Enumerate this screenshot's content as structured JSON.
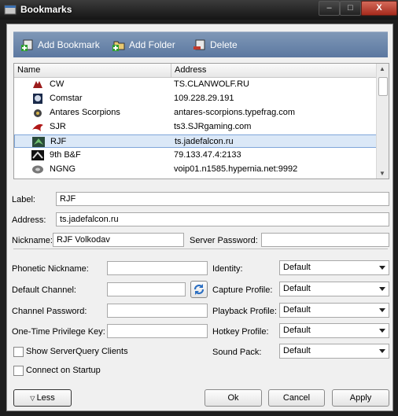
{
  "window": {
    "title": "Bookmarks",
    "controls": [
      "–",
      "□",
      "X"
    ]
  },
  "toolbar": {
    "add_bookmark": "Add Bookmark",
    "add_folder": "Add Folder",
    "delete": "Delete"
  },
  "list": {
    "headers": {
      "name": "Name",
      "address": "Address"
    },
    "rows": [
      {
        "name": "CW",
        "address": "TS.CLANWOLF.RU",
        "icon": "wolf-icon"
      },
      {
        "name": "Comstar",
        "address": "109.228.29.191",
        "icon": "comstar-icon"
      },
      {
        "name": "Antares Scorpions",
        "address": "antares-scorpions.typefrag.com",
        "icon": "scorpion-icon"
      },
      {
        "name": "SJR",
        "address": "ts3.SJRgaming.com",
        "icon": "sjr-icon"
      },
      {
        "name": "RJF",
        "address": "ts.jadefalcon.ru",
        "icon": "falcon-icon",
        "selected": true
      },
      {
        "name": "9th B&F",
        "address": "79.133.47.4:2133",
        "icon": "bf-icon"
      },
      {
        "name": "NGNG",
        "address": "voip01.n1585.hypernia.net:9992",
        "icon": "ngng-icon"
      }
    ]
  },
  "form": {
    "label": {
      "label": "Label:",
      "value": "RJF"
    },
    "address": {
      "label": "Address:",
      "value": "ts.jadefalcon.ru"
    },
    "nickname": {
      "label": "Nickname:",
      "value": "RJF Volkodav"
    },
    "server_password": {
      "label": "Server Password:",
      "value": ""
    },
    "phonetic_nickname": {
      "label": "Phonetic Nickname:",
      "value": ""
    },
    "default_channel": {
      "label": "Default Channel:",
      "value": ""
    },
    "channel_password": {
      "label": "Channel Password:",
      "value": ""
    },
    "privilege_key": {
      "label": "One-Time Privilege Key:",
      "value": ""
    },
    "identity": {
      "label": "Identity:",
      "value": "Default"
    },
    "capture_profile": {
      "label": "Capture Profile:",
      "value": "Default"
    },
    "playback_profile": {
      "label": "Playback Profile:",
      "value": "Default"
    },
    "hotkey_profile": {
      "label": "Hotkey Profile:",
      "value": "Default"
    },
    "sound_pack": {
      "label": "Sound Pack:",
      "value": "Default"
    },
    "show_serverquery": {
      "label": "Show ServerQuery Clients",
      "checked": false
    },
    "connect_startup": {
      "label": "Connect on Startup",
      "checked": false
    }
  },
  "buttons": {
    "less": "Less",
    "ok": "Ok",
    "cancel": "Cancel",
    "apply": "Apply"
  }
}
